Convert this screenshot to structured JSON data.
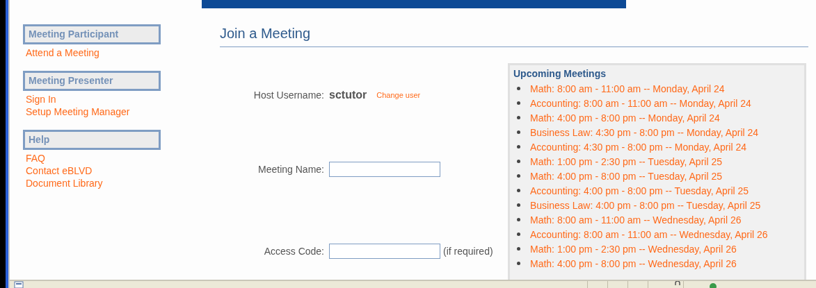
{
  "sidebar": {
    "sections": [
      {
        "title": "Meeting Participant",
        "links": [
          "Attend a Meeting"
        ]
      },
      {
        "title": "Meeting Presenter",
        "links": [
          "Sign In",
          "Setup Meeting Manager"
        ]
      },
      {
        "title": "Help",
        "links": [
          "FAQ",
          "Contact eBLVD",
          "Document Library"
        ]
      }
    ]
  },
  "page_title": "Join a Meeting",
  "form": {
    "host_label": "Host Username:",
    "host_value": "sctutor",
    "change_user": "Change user",
    "fields": [
      {
        "label": "Meeting Name:"
      },
      {
        "label": "Access Code:",
        "hint": "(if required)"
      }
    ]
  },
  "upcoming": {
    "title": "Upcoming Meetings",
    "items": [
      "Math: 8:00 am - 11:00 am -- Monday, April 24",
      "Accounting: 8:00 am - 11:00 am -- Monday, April 24",
      "Math: 4:00 pm - 8:00 pm -- Monday, April 24",
      "Business Law: 4:30 pm - 8:00 pm -- Monday, April 24",
      "Accounting: 4:30 pm - 8:00 pm -- Monday, April 24",
      "Math: 1:00 pm - 2:30 pm -- Tuesday, April 25",
      "Math: 4:00 pm - 8:00 pm -- Tuesday, April 25",
      "Accounting: 4:00 pm - 8:00 pm -- Tuesday, April 25",
      "Business Law: 4:00 pm - 8:00 pm -- Tuesday, April 25",
      "Math: 8:00 am - 11:00 am -- Wednesday, April 26",
      "Accounting: 8:00 am - 11:00 am -- Wednesday, April 26",
      "Math: 1:00 pm - 2:30 pm -- Wednesday, April 26",
      "Math: 4:00 pm - 8:00 pm -- Wednesday, April 26"
    ]
  }
}
